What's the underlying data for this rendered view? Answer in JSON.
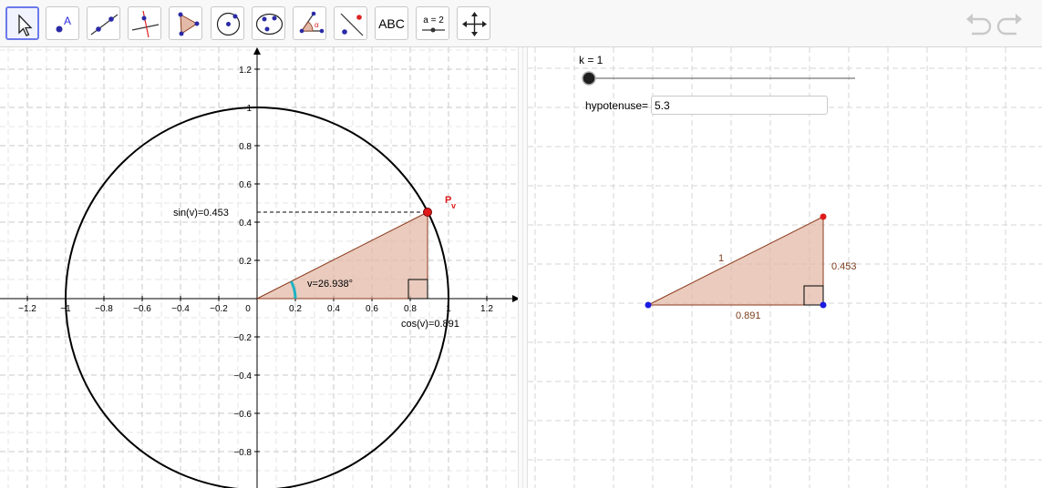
{
  "toolbar": {
    "tools": [
      {
        "name": "move-tool",
        "icon": "pointer-arrow-icon"
      },
      {
        "name": "point-tool",
        "icon": "point-a-icon",
        "label": "A"
      },
      {
        "name": "line-tool",
        "icon": "line-through-points-icon"
      },
      {
        "name": "perpendicular-tool",
        "icon": "perpendicular-line-icon"
      },
      {
        "name": "polygon-tool",
        "icon": "polygon-icon"
      },
      {
        "name": "circle-tool",
        "icon": "circle-center-point-icon"
      },
      {
        "name": "conic-tool",
        "icon": "ellipse-icon"
      },
      {
        "name": "angle-tool",
        "icon": "angle-icon",
        "label": "α"
      },
      {
        "name": "reflect-tool",
        "icon": "reflect-icon"
      },
      {
        "name": "text-tool",
        "icon": "text-icon",
        "label": "ABC"
      },
      {
        "name": "slider-tool",
        "icon": "slider-icon",
        "label": "a = 2"
      },
      {
        "name": "move-view-tool",
        "icon": "move-graphics-view-icon"
      }
    ],
    "undo_icon": "undo-icon",
    "redo_icon": "redo-icon"
  },
  "graphics1": {
    "x_ticks": [
      "−1.2",
      "−1",
      "−0.8",
      "−0.6",
      "−0.4",
      "−0.2",
      "0",
      "0.2",
      "0.4",
      "0.6",
      "0.8",
      "1",
      "1.2"
    ],
    "y_ticks_pos": [
      "1.2",
      "1",
      "0.8",
      "0.6",
      "0.4",
      "0.2"
    ],
    "y_ticks_neg": [
      "−0.2",
      "−0.4",
      "−0.6",
      "−0.8"
    ],
    "point_label": "P",
    "point_label_sub": "v",
    "sin_label": "sin(v)=0.453",
    "cos_label": "cos(v)=0.891",
    "angle_label": "v=26.938°",
    "colors": {
      "triangle_fill": "#e3b9a8",
      "triangle_stroke": "#8a3a1c",
      "point": "#e01a1a",
      "angle_arc": "#1bb3c4"
    }
  },
  "graphics2": {
    "slider_label": "k = 1",
    "slider_value": 1,
    "input_label": "hypotenuse=",
    "input_value": "5.3",
    "hyp_label": "1",
    "opp_label": "0.453",
    "adj_label": "0.891",
    "colors": {
      "vertex": "#1a1ae0",
      "top_vertex": "#e01a1a"
    }
  }
}
